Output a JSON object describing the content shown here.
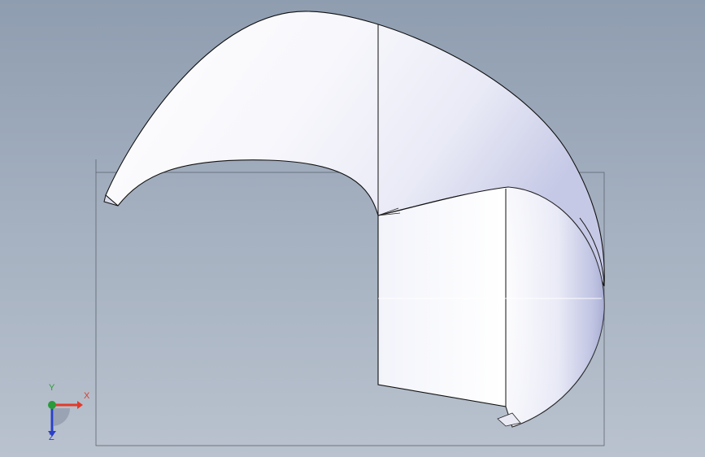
{
  "scene": {
    "background_top": "#8f9db0",
    "background_bottom": "#b9c2ce",
    "surface_color": "#f4f5fb",
    "surface_shade": "#c9ccea",
    "edge_color": "#111111"
  },
  "triad": {
    "x_label": "X",
    "y_label": "Y",
    "z_label": "Z",
    "x_color": "#e23a2a",
    "y_color": "#2b9a3a",
    "z_color": "#2b3fc9"
  }
}
